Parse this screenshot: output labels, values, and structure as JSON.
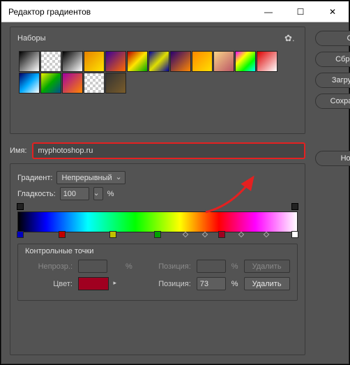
{
  "titlebar": {
    "title": "Редактор градиентов"
  },
  "presets": {
    "label": "Наборы"
  },
  "buttons": {
    "ok": "OK",
    "reset": "Сбросить",
    "load": "Загрузить...",
    "save": "Сохранить...",
    "new": "Новый",
    "delete": "Удалить"
  },
  "fields": {
    "name_label": "Имя:",
    "name_value": "myphotoshop.ru",
    "gradient_label": "Градиент:",
    "gradient_type": "Непрерывный",
    "smoothness_label": "Гладкость:",
    "smoothness_value": "100",
    "percent": "%"
  },
  "control_points": {
    "title": "Контрольные точки",
    "opacity_label": "Непрозр.:",
    "opacity_position_label": "Позиция:",
    "color_label": "Цвет:",
    "color_position_label": "Позиция:",
    "color_position_value": "73",
    "color_value": "#a00020"
  },
  "preset_gradients": [
    "linear-gradient(135deg,#000,#fff)",
    "repeating-conic-gradient(#ccc 0 25%,#fff 0 50%) 0 0/8px 8px",
    "linear-gradient(135deg,#000,#fff)",
    "linear-gradient(135deg,#e88200,#ffe500)",
    "linear-gradient(135deg,#3a0099,#ff6a00)",
    "linear-gradient(135deg,#b80000,#ffe500,#00a800)",
    "linear-gradient(135deg,#0000a0,#e0e000,#0000a0)",
    "linear-gradient(135deg,#2a0070,#ff8800)",
    "linear-gradient(135deg,#ff8800,#ffe000)",
    "linear-gradient(135deg,#f7d488,#b56)",
    "linear-gradient(135deg,#f0f,#ff0,#0f0,#0ff)",
    "linear-gradient(135deg,#d00,#fff)",
    "linear-gradient(135deg,#006,#0af,#fff)",
    "linear-gradient(135deg,#f0f000,#00a800,#005090)",
    "linear-gradient(135deg,#a000a0,#ff8800)",
    "repeating-conic-gradient(#ccc 0 25%,#fff 0 50%) 0 0/8px 8px",
    "linear-gradient(135deg,#333,#7a5c2a)"
  ],
  "color_stops": [
    {
      "pos": 1,
      "color": "#0000c0"
    },
    {
      "pos": 16,
      "color": "#c00000"
    },
    {
      "pos": 34,
      "color": "#c0c000"
    },
    {
      "pos": 50,
      "color": "#00a000"
    },
    {
      "pos": 73,
      "color": "#a00020"
    },
    {
      "pos": 99,
      "color": "#ffffff"
    }
  ],
  "opacity_stops": [
    {
      "pos": 1
    },
    {
      "pos": 99
    }
  ],
  "midpoints": [
    60,
    67,
    80,
    89
  ]
}
